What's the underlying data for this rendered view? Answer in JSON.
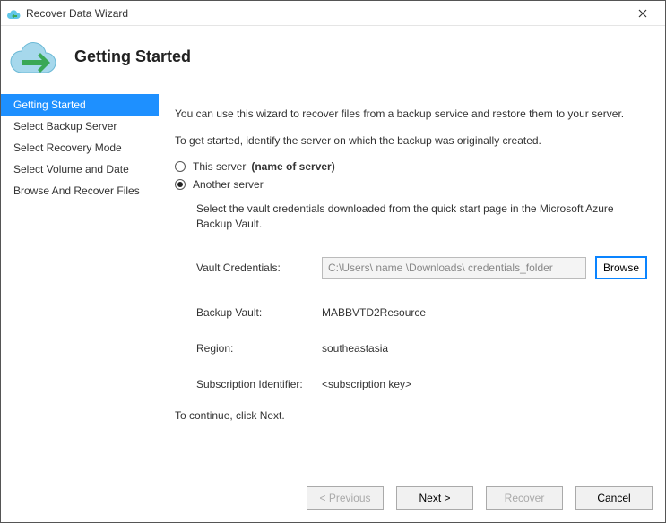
{
  "window": {
    "title": "Recover Data Wizard"
  },
  "header": {
    "title": "Getting Started"
  },
  "sidebar": {
    "items": [
      {
        "label": "Getting Started",
        "selected": true
      },
      {
        "label": "Select Backup Server",
        "selected": false
      },
      {
        "label": "Select Recovery Mode",
        "selected": false
      },
      {
        "label": "Select Volume and Date",
        "selected": false
      },
      {
        "label": "Browse And Recover Files",
        "selected": false
      }
    ]
  },
  "content": {
    "intro": "You can use this wizard to recover files from a backup service and restore them to your server.",
    "identify_prompt": "To get started, identify the server on which the backup was originally created.",
    "radio_this_server": "This server",
    "radio_this_server_paren": "(name of server)",
    "radio_another_server": "Another server",
    "vault_hint": "Select the vault credentials downloaded from the quick start page in the Microsoft Azure Backup Vault.",
    "vault_credentials_label": "Vault Credentials:",
    "vault_credentials_value": "C:\\Users\\ name \\Downloads\\ credentials_folder",
    "browse_label": "Browse",
    "backup_vault_label": "Backup Vault:",
    "backup_vault_value": "MABBVTD2Resource",
    "region_label": "Region:",
    "region_value": "southeastasia",
    "subscription_label": "Subscription Identifier:",
    "subscription_value": "<subscription key>",
    "continue_note": "To continue, click Next."
  },
  "buttons": {
    "previous": "< Previous",
    "next": "Next >",
    "recover": "Recover",
    "cancel": "Cancel"
  }
}
